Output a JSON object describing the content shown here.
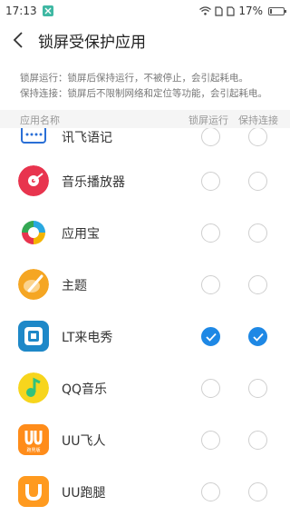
{
  "status_bar": {
    "time": "17:13",
    "battery": "17%",
    "battery_level": 0.17
  },
  "header": {
    "title": "锁屏受保护应用"
  },
  "description": {
    "line1": "锁屏运行：锁屏后保持运行，不被停止，会引起耗电。",
    "line2": "保持连接：锁屏后不限制网络和定位等功能，会引起耗电。"
  },
  "columns": {
    "app_name": "应用名称",
    "lock_run": "锁屏运行",
    "keep_connect": "保持连接"
  },
  "apps": [
    {
      "name": "讯飞语记",
      "icon": "xunfei-note-icon",
      "lock_run": false,
      "keep_connect": false
    },
    {
      "name": "音乐播放器",
      "icon": "music-player-icon",
      "lock_run": false,
      "keep_connect": false
    },
    {
      "name": "应用宝",
      "icon": "yingyongbao-icon",
      "lock_run": false,
      "keep_connect": false
    },
    {
      "name": "主题",
      "icon": "theme-icon",
      "lock_run": false,
      "keep_connect": false
    },
    {
      "name": "LT来电秀",
      "icon": "lt-call-show-icon",
      "lock_run": true,
      "keep_connect": true
    },
    {
      "name": "QQ音乐",
      "icon": "qq-music-icon",
      "lock_run": false,
      "keep_connect": false
    },
    {
      "name": "UU飞人",
      "icon": "uu-feiren-icon",
      "icon_caption": "跑男版",
      "lock_run": false,
      "keep_connect": false
    },
    {
      "name": "UU跑腿",
      "icon": "uu-paotui-icon",
      "lock_run": false,
      "keep_connect": false
    }
  ],
  "colors": {
    "accent": "#1e88e5",
    "header_bg": "#f5f5f5"
  }
}
